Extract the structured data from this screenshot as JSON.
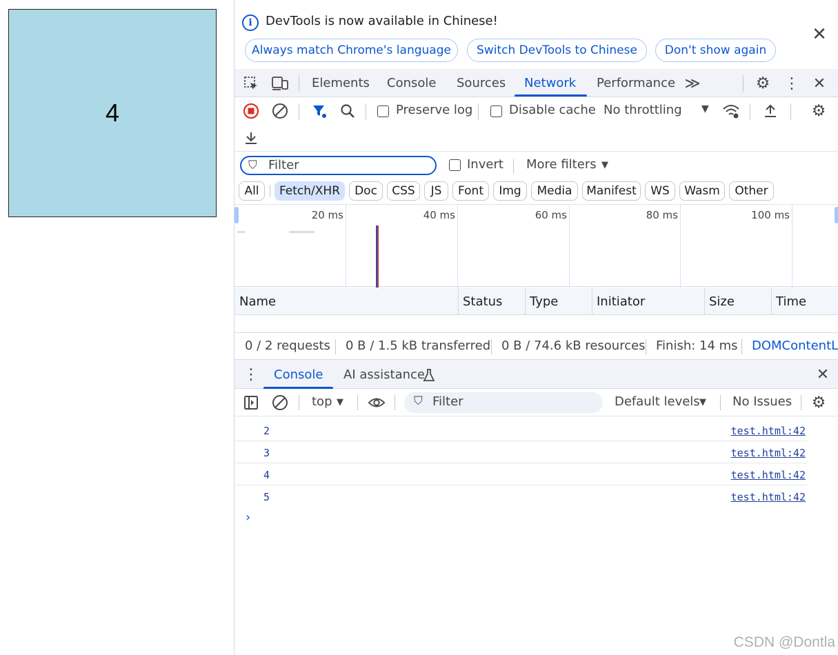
{
  "page": {
    "box_value": "4",
    "box_color": "#add8e6"
  },
  "infobar": {
    "message": "DevTools is now available in Chinese!",
    "buttons": [
      "Always match Chrome's language",
      "Switch DevTools to Chinese",
      "Don't show again"
    ]
  },
  "tabs": {
    "items": [
      "Elements",
      "Console",
      "Sources",
      "Network",
      "Performance"
    ],
    "active": "Network"
  },
  "network_toolbar": {
    "preserve_log": "Preserve log",
    "disable_cache": "Disable cache",
    "throttling": "No throttling"
  },
  "filter": {
    "placeholder": "Filter",
    "invert": "Invert",
    "more_filters": "More filters",
    "types": [
      "All",
      "Fetch/XHR",
      "Doc",
      "CSS",
      "JS",
      "Font",
      "Img",
      "Media",
      "Manifest",
      "WS",
      "Wasm",
      "Other"
    ],
    "selected_type": "Fetch/XHR"
  },
  "overview": {
    "ticks": [
      "20 ms",
      "40 ms",
      "60 ms",
      "80 ms",
      "100 ms"
    ]
  },
  "table": {
    "columns": [
      "Name",
      "Status",
      "Type",
      "Initiator",
      "Size",
      "Time"
    ]
  },
  "status": {
    "requests": "0 / 2 requests",
    "transferred": "0 B / 1.5 kB transferred",
    "resources": "0 B / 74.6 kB resources",
    "finish": "Finish: 14 ms",
    "dom": "DOMContentL"
  },
  "drawer": {
    "tabs": [
      "Console",
      "AI assistance"
    ],
    "context": "top",
    "filter_placeholder": "Filter",
    "levels": "Default levels",
    "issues": "No Issues"
  },
  "console": {
    "logs": [
      {
        "value": "2",
        "source": "test.html:42"
      },
      {
        "value": "3",
        "source": "test.html:42"
      },
      {
        "value": "4",
        "source": "test.html:42"
      },
      {
        "value": "5",
        "source": "test.html:42"
      }
    ]
  },
  "watermark": "CSDN @Dontla",
  "colors": {
    "accent": "#0b57d0",
    "record": "#d93025"
  }
}
